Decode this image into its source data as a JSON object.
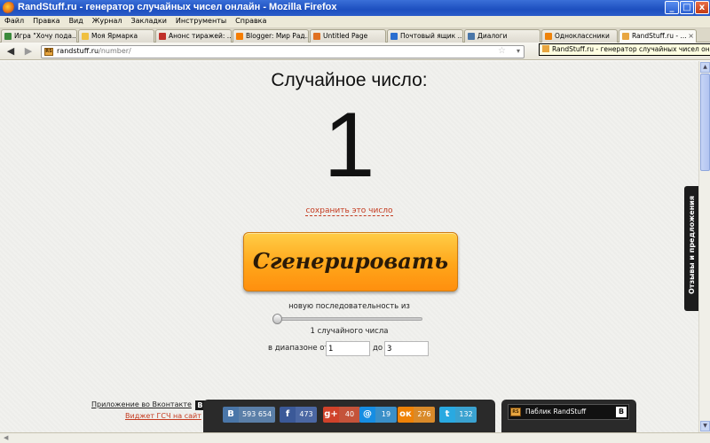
{
  "window": {
    "title": "RandStuff.ru - генератор случайных чисел онлайн - Mozilla Firefox",
    "minimize": "_",
    "maximize": "□",
    "close": "x"
  },
  "menu": [
    "Файл",
    "Правка",
    "Вид",
    "Журнал",
    "Закладки",
    "Инструменты",
    "Справка"
  ],
  "tabs": [
    {
      "label": "Игра \"Хочу пода...",
      "color": "#3b8a3b"
    },
    {
      "label": "Моя Ярмарка",
      "color": "#f0c040"
    },
    {
      "label": "Анонс тиражей: ...",
      "color": "#c0302a"
    },
    {
      "label": "Blogger: Мир Рад...",
      "color": "#f57d00"
    },
    {
      "label": "Untitled Page",
      "color": "#e07020"
    },
    {
      "label": "Почтовый ящик ...",
      "color": "#2a6ed0"
    },
    {
      "label": "Диалоги",
      "color": "#4a76a8"
    },
    {
      "label": "Одноклассники",
      "color": "#ee8208"
    },
    {
      "label": "RandStuff.ru - ...",
      "color": "#e8a640",
      "active": true
    }
  ],
  "nav": {
    "back": "◀",
    "forward": "▶",
    "url_domain": "randstuff.ru",
    "url_path": "/number/",
    "star": "☆",
    "dropdown": "▾",
    "site_icon_text": "RS"
  },
  "tooltip": "RandStuff.ru - генератор случайных чисел онлайн",
  "main": {
    "heading": "Случайное число:",
    "number": "1",
    "save_link": "сохранить это число",
    "generate_button": "Сгенерировать",
    "sequence_label": "новую последовательность из",
    "count_label": "1 случайного числа",
    "range_from_label": "в диапазоне от",
    "range_from_value": "1",
    "range_to_label": "до",
    "range_to_value": "3",
    "slider_value_fraction": 0.0
  },
  "feedback_tab": "Отзывы и предложения",
  "footer": {
    "vk_app_text": "Приложение во Вконтакте",
    "vk_badge": "В",
    "widget_link": "Виджет ГСЧ на сайт",
    "shares": [
      {
        "network": "vkontakte",
        "icon": "В",
        "count": "593 654",
        "icon_color": "#4a76a8",
        "count_color": "#5b7fa8"
      },
      {
        "network": "facebook",
        "icon": "f",
        "count": "473",
        "icon_color": "#3b5998",
        "count_color": "#4b67a3"
      },
      {
        "network": "google-plus",
        "icon": "g+",
        "count": "40",
        "icon_color": "#d0422a",
        "count_color": "#c4533a"
      },
      {
        "network": "mail-ru",
        "icon": "@",
        "count": "19",
        "icon_color": "#168de2",
        "count_color": "#3a8fc8"
      },
      {
        "network": "odnoklassniki",
        "icon": "ок",
        "count": "276",
        "icon_color": "#ee8208",
        "count_color": "#d98a2a"
      },
      {
        "network": "twitter",
        "icon": "t",
        "count": "132",
        "icon_color": "#29a9e1",
        "count_color": "#3aa2d0"
      }
    ],
    "public_text": "Паблик RandStuff",
    "public_vk": "В",
    "public_icon_text": "RS"
  }
}
